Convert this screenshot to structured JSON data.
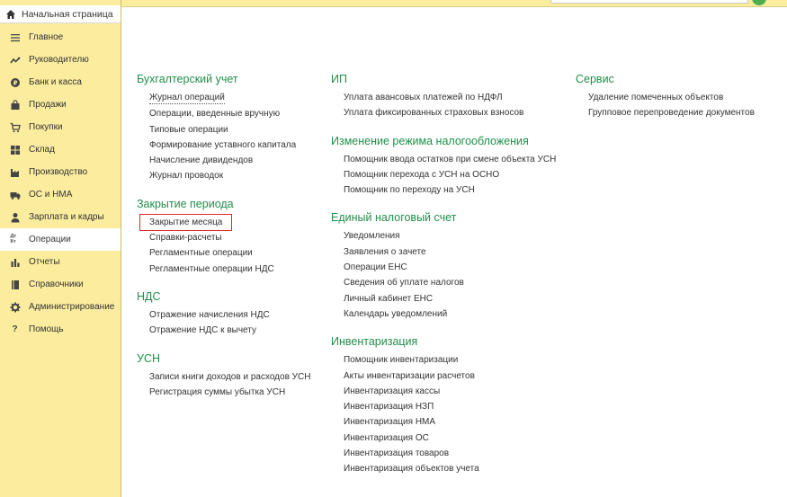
{
  "home": {
    "label": "Начальная страница",
    "icon": "home-icon"
  },
  "nav": [
    {
      "label": "Главное",
      "icon": "menu-lines-icon",
      "active": false
    },
    {
      "label": "Руководителю",
      "icon": "trend-chart-icon",
      "active": false
    },
    {
      "label": "Банк и касса",
      "icon": "coin-icon",
      "active": false
    },
    {
      "label": "Продажи",
      "icon": "shopping-bag-icon",
      "active": false
    },
    {
      "label": "Покупки",
      "icon": "shopping-cart-icon",
      "active": false
    },
    {
      "label": "Склад",
      "icon": "warehouse-grid-icon",
      "active": false
    },
    {
      "label": "Производство",
      "icon": "factory-icon",
      "active": false
    },
    {
      "label": "ОС и НМА",
      "icon": "truck-icon",
      "active": false
    },
    {
      "label": "Зарплата и кадры",
      "icon": "person-icon",
      "active": false
    },
    {
      "label": "Операции",
      "icon": "debit-credit-icon",
      "icon_text": "Дт Кт",
      "active": true
    },
    {
      "label": "Отчеты",
      "icon": "bar-chart-icon",
      "active": false
    },
    {
      "label": "Справочники",
      "icon": "book-icon",
      "active": false
    },
    {
      "label": "Администрирование",
      "icon": "gear-icon",
      "active": false
    },
    {
      "label": "Помощь",
      "icon": "question-icon",
      "active": false
    }
  ],
  "columns": [
    {
      "sections": [
        {
          "title": "Бухгалтерский учет",
          "items": [
            "Журнал операций",
            "Операции, введенные вручную",
            "Типовые операции",
            "Формирование уставного капитала",
            "Начисление дивидендов",
            "Журнал проводок"
          ]
        },
        {
          "title": "Закрытие периода",
          "items": [
            "Закрытие месяца",
            "Справки-расчеты",
            "Регламентные операции",
            "Регламентные операции НДС"
          ]
        },
        {
          "title": "НДС",
          "items": [
            "Отражение начисления НДС",
            "Отражение НДС к вычету"
          ]
        },
        {
          "title": "УСН",
          "items": [
            "Записи книги доходов и расходов УСН",
            "Регистрация суммы убытка УСН"
          ]
        }
      ]
    },
    {
      "sections": [
        {
          "title": "ИП",
          "items": [
            "Уплата авансовых платежей по НДФЛ",
            "Уплата фиксированных страховых взносов"
          ]
        },
        {
          "title": "Изменение режима налогообложения",
          "items": [
            "Помощник ввода остатков при смене объекта УСН",
            "Помощник перехода с УСН на ОСНО",
            "Помощник по переходу на УСН"
          ]
        },
        {
          "title": "Единый налоговый счет",
          "items": [
            "Уведомления",
            "Заявления о зачете",
            "Операции ЕНС",
            "Сведения об уплате налогов",
            "Личный кабинет ЕНС",
            "Календарь уведомлений"
          ]
        },
        {
          "title": "Инвентаризация",
          "items": [
            "Помощник инвентаризации",
            "Акты инвентаризации расчетов",
            "Инвентаризация кассы",
            "Инвентаризация НЗП",
            "Инвентаризация НМА",
            "Инвентаризация ОС",
            "Инвентаризация товаров",
            "Инвентаризация объектов учета"
          ]
        }
      ]
    },
    {
      "sections": [
        {
          "title": "Сервис",
          "items": [
            "Удаление помеченных объектов",
            "Групповое перепроведение документов"
          ]
        }
      ]
    }
  ],
  "colors": {
    "sidebar": "#fbec9e",
    "section_title": "#1f8f4a",
    "highlight": "#e0262e",
    "avatar": "#4caf50"
  }
}
